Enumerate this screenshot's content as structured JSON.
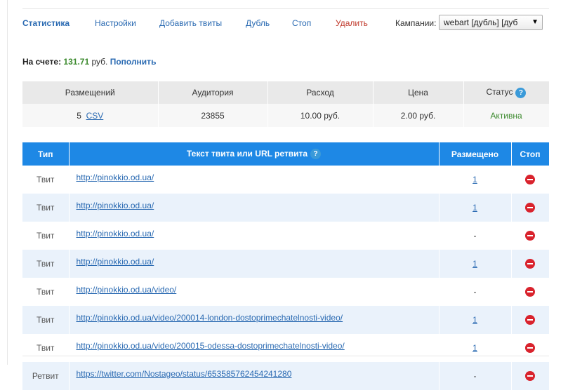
{
  "nav": {
    "items": [
      {
        "label": "Статистика"
      },
      {
        "label": "Настройки"
      },
      {
        "label": "Добавить твиты"
      },
      {
        "label": "Дубль"
      },
      {
        "label": "Стоп"
      },
      {
        "label": "Удалить"
      }
    ],
    "campaign_label": "Кампании:",
    "campaign_value": "webart [дубль] [дуб",
    "campaign_arrow": "▼"
  },
  "balance": {
    "label": "На счете:",
    "amount": "131.71",
    "currency": "руб.",
    "topup": "Пополнить"
  },
  "stats": {
    "headers": [
      "Размещений",
      "Аудитория",
      "Расход",
      "Цена",
      "Статус"
    ],
    "help": "?",
    "placements": "5",
    "csv": "CSV",
    "audience": "23855",
    "expense": "10.00 руб.",
    "price": "2.00 руб.",
    "status": "Активна"
  },
  "tweets": {
    "headers": {
      "type": "Тип",
      "text": "Текст твита или URL ретвита",
      "placed": "Размещено",
      "stop": "Стоп"
    },
    "help": "?",
    "rows": [
      {
        "type": "Твит",
        "text": "http://pinokkio.od.ua/",
        "placed": "1"
      },
      {
        "type": "Твит",
        "text": "http://pinokkio.od.ua/",
        "placed": "1"
      },
      {
        "type": "Твит",
        "text": "http://pinokkio.od.ua/",
        "placed": "-"
      },
      {
        "type": "Твит",
        "text": "http://pinokkio.od.ua/",
        "placed": "1"
      },
      {
        "type": "Твит",
        "text": "http://pinokkio.od.ua/video/",
        "placed": "-"
      },
      {
        "type": "Твит",
        "text": "http://pinokkio.od.ua/video/200014-london-dostoprimechatelnosti-video/",
        "placed": "1"
      },
      {
        "type": "Твит",
        "text": "http://pinokkio.od.ua/video/200015-odessa-dostoprimechatelnosti-video/",
        "placed": "1"
      },
      {
        "type": "Ретвит",
        "text": "https://twitter.com/Nostageo/status/653585762454241280",
        "placed": "-"
      }
    ]
  },
  "colors": {
    "accent_blue": "#1e88e5",
    "link": "#2a6ab2",
    "green": "#3c8a2e",
    "danger": "#c0392b",
    "stop_icon": "#d9232d"
  }
}
